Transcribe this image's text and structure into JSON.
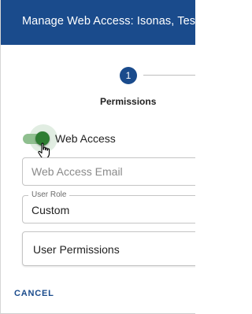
{
  "dialog": {
    "title": "Manage Web Access: Isonas, Tes"
  },
  "stepper": {
    "step_number": "1",
    "step_label": "Permissions"
  },
  "web_access_toggle": {
    "label": "Web Access",
    "checked": true
  },
  "email_field": {
    "placeholder": "Web Access Email",
    "value": ""
  },
  "user_role": {
    "legend": "User Role",
    "value": "Custom"
  },
  "user_permissions": {
    "label": "User Permissions"
  },
  "actions": {
    "cancel_label": "CANCEL"
  },
  "colors": {
    "brand": "#1a4b8c",
    "toggle_on": "#2e7d32"
  },
  "icons": [
    "hand-pointer-cursor-icon"
  ]
}
